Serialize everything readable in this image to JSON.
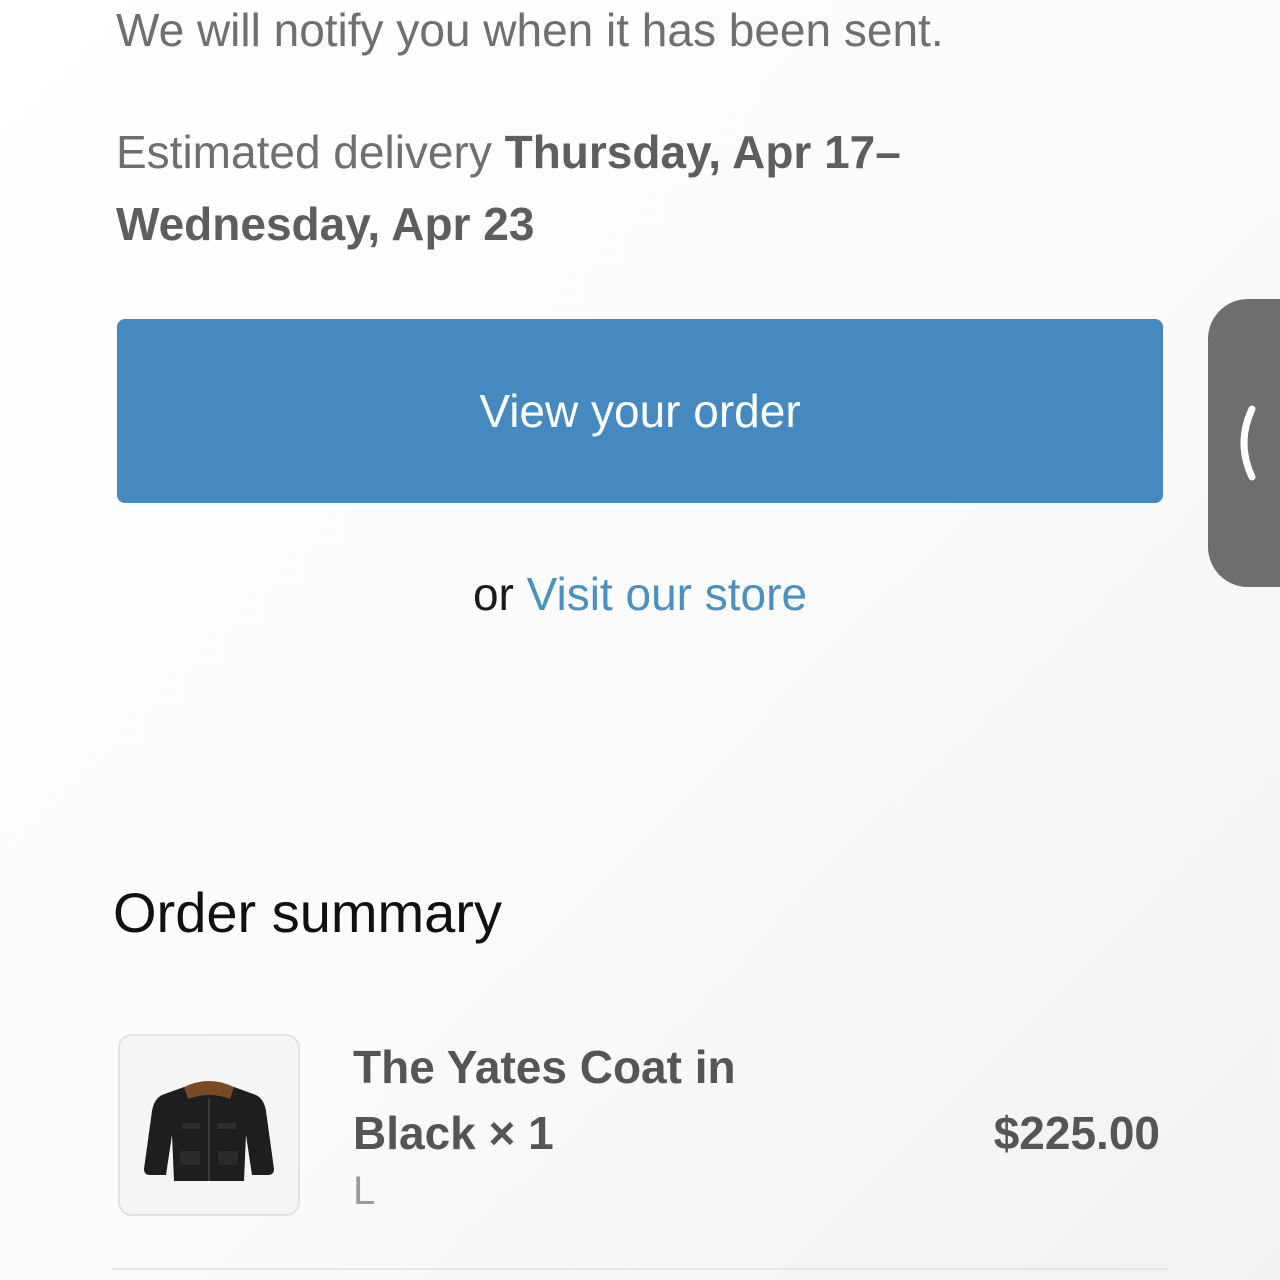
{
  "notice": {
    "sent_text": "We will notify you when it has been sent."
  },
  "delivery": {
    "prefix": "Estimated delivery ",
    "dates": "Thursday, Apr 17–Wednesday, Apr 23"
  },
  "actions": {
    "view_order_label": "View your order",
    "or_text": "or ",
    "visit_store_label": "Visit our store"
  },
  "side_tab": {
    "icon": "chevron-left-icon"
  },
  "order_summary": {
    "title": "Order summary",
    "items": [
      {
        "name": "The Yates Coat in Black × 1",
        "variant": "L",
        "price": "$225.00",
        "image_icon": "coat-icon"
      }
    ]
  },
  "colors": {
    "button_bg": "#448ac1",
    "link": "#4a90c2",
    "side_tab_bg": "#6e6e6e"
  }
}
